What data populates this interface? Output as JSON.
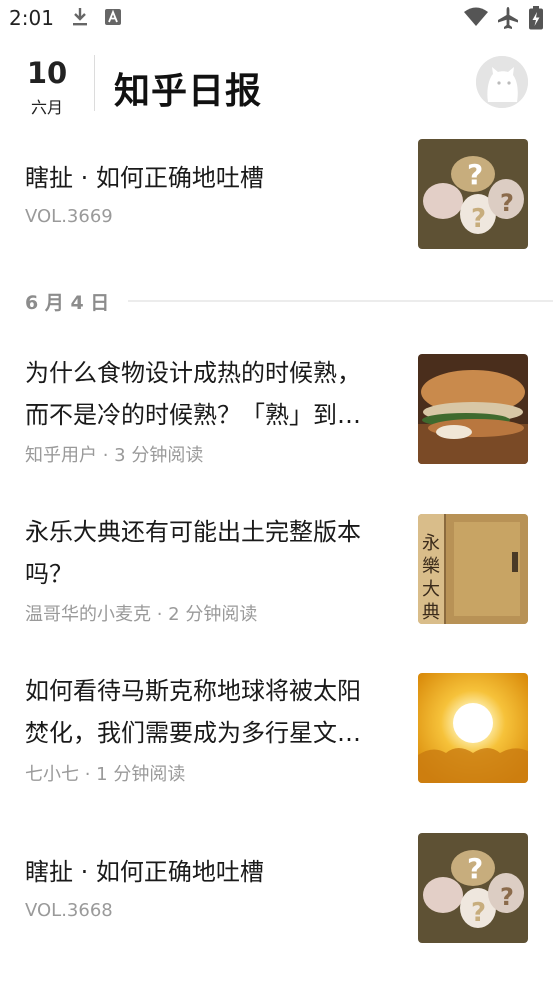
{
  "status_bar": {
    "time": "2:01",
    "icons": [
      "download-icon",
      "font-a-icon",
      "wifi-icon",
      "airplane-mode-icon",
      "battery-charging-icon"
    ]
  },
  "header": {
    "day": "10",
    "month": "六月",
    "title": "知乎日报"
  },
  "top_story": {
    "title": "瞎扯 · 如何正确地吐槽",
    "meta": "VOL.3669",
    "thumb": "question-marks-thumbnail"
  },
  "section": {
    "label": "6 月 4 日"
  },
  "stories": [
    {
      "title_lines": [
        "为什么食物设计成热的时候熟，",
        "而不是冷的时候熟？「熟」到…"
      ],
      "meta": "知乎用户 · 3 分钟阅读",
      "thumb": "sandwich-thumbnail"
    },
    {
      "title_lines": [
        "永乐大典还有可能出土完整版本",
        "吗？"
      ],
      "meta": "温哥华的小麦克 · 2 分钟阅读",
      "thumb": "ancient-book-thumbnail"
    },
    {
      "title_lines": [
        "如何看待马斯克称地球将被太阳",
        "焚化，我们需要成为多行星文…"
      ],
      "meta": "七小七 · 1 分钟阅读",
      "thumb": "sun-thumbnail"
    },
    {
      "title_lines": [
        "瞎扯 · 如何正确地吐槽"
      ],
      "meta": "VOL.3668",
      "thumb": "question-marks-thumbnail"
    }
  ]
}
